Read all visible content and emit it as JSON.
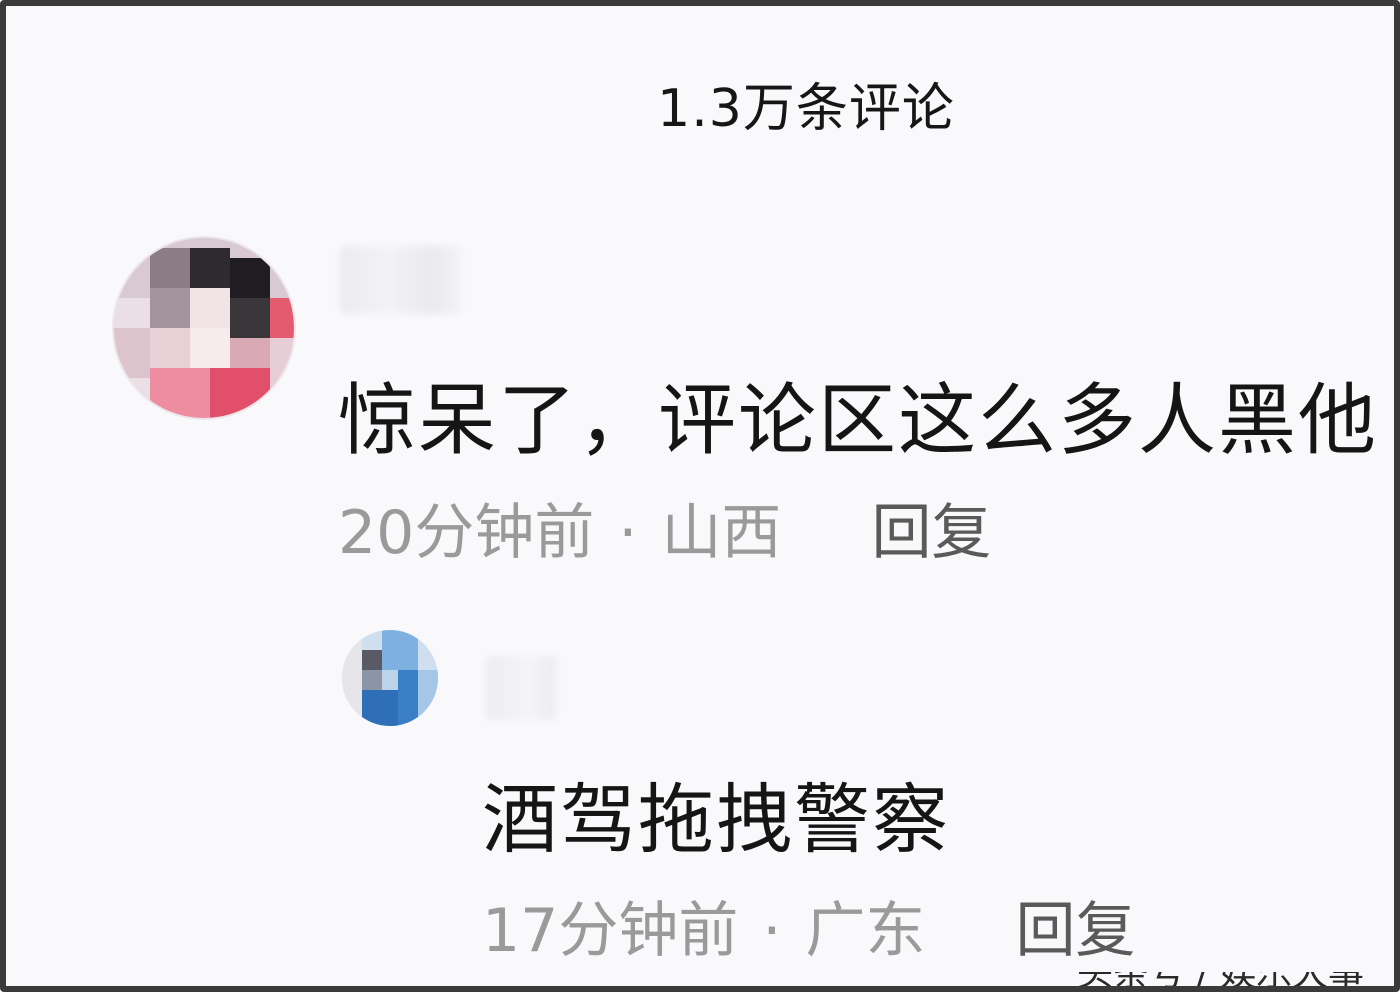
{
  "header": {
    "title": "1.3万条评论"
  },
  "comments": [
    {
      "text": "惊呆了，评论区这么多人黑他",
      "time": "20分钟前",
      "separator": "·",
      "location": "山西",
      "reply_label": "回复"
    },
    {
      "text": "酒驾拖拽警察",
      "time": "17分钟前",
      "separator": "·",
      "location": "广东",
      "reply_label": "回复"
    }
  ],
  "watermark": "头条号 / 娱乐大事件"
}
